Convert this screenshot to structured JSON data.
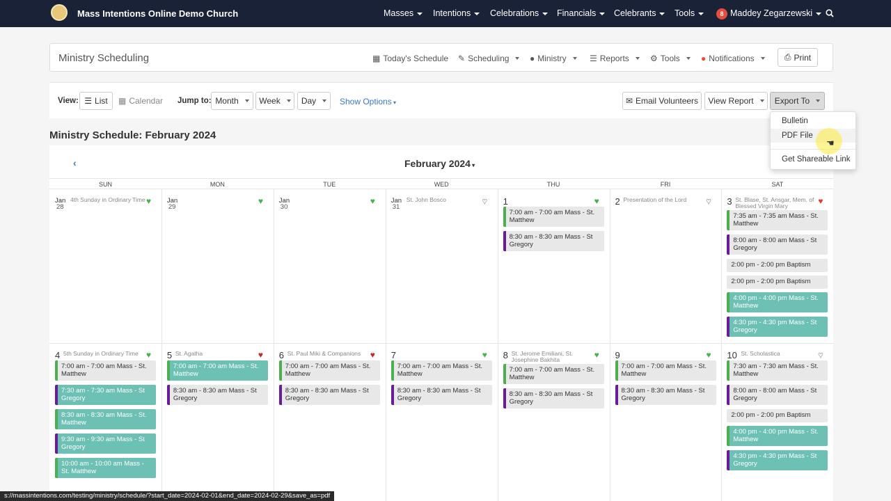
{
  "nav": {
    "brand": "Mass Intentions Online Demo Church",
    "items": [
      "Masses",
      "Intentions",
      "Celebrations",
      "Financials",
      "Celebrants",
      "Tools"
    ],
    "badge": "8",
    "user": "Maddey Zegarzewski"
  },
  "panel": {
    "title": "Ministry Scheduling",
    "menu": [
      "Today's Schedule",
      "Scheduling",
      "Ministry",
      "Reports",
      "Tools",
      "Notifications"
    ],
    "print": "Print"
  },
  "toolbar": {
    "view_label": "View:",
    "list": "List",
    "calendar": "Calendar",
    "jump_label": "Jump to:",
    "month": "Month",
    "week": "Week",
    "day": "Day",
    "show_options": "Show Options",
    "email": "Email Volunteers",
    "view_report": "View Report",
    "export": "Export To"
  },
  "dropdown": {
    "bulletin": "Bulletin",
    "pdf": "PDF File",
    "share": "Get Shareable Link"
  },
  "heading": "Ministry Schedule: February 2024",
  "calendar": {
    "month_title": "February 2024",
    "dow": [
      "SUN",
      "MON",
      "TUE",
      "WED",
      "THU",
      "FRI",
      "SAT"
    ],
    "week1": [
      {
        "num": "Jan",
        "sub": "28",
        "feast": "4th Sunday in Ordinary Time",
        "events": []
      },
      {
        "num": "Jan",
        "sub": "29",
        "feast": "",
        "events": []
      },
      {
        "num": "Jan",
        "sub": "30",
        "feast": "",
        "events": []
      },
      {
        "num": "Jan",
        "sub": "31",
        "feast": "St. John Bosco",
        "events": []
      },
      {
        "num": "1",
        "feast": "",
        "events": [
          {
            "t": "7:00 am - 7:00 am Mass - St. Matthew",
            "s": "g"
          },
          {
            "t": "8:30 am - 8:30 am Mass - St Gregory",
            "s": "p"
          }
        ]
      },
      {
        "num": "2",
        "feast": "Presentation of the Lord",
        "events": []
      },
      {
        "num": "3",
        "feast": "St. Blase, St. Ansgar, Mem. of Blessed Virgin Mary",
        "events": [
          {
            "t": "7:35 am - 7:35 am Mass - St. Matthew",
            "s": "g"
          },
          {
            "t": "8:00 am - 8:00 am Mass - St Gregory",
            "s": "p"
          },
          {
            "t": "2:00 pm - 2:00 pm Baptism",
            "s": "n"
          },
          {
            "t": "2:00 pm - 2:00 pm Baptism",
            "s": "n"
          },
          {
            "t": "4:00 pm - 4:00 pm Mass - St. Matthew",
            "s": "tg"
          },
          {
            "t": "4:30 pm - 4:30 pm Mass - St Gregory",
            "s": "tp"
          }
        ]
      }
    ],
    "week2": [
      {
        "num": "4",
        "feast": "5th Sunday in Ordinary Time",
        "events": [
          {
            "t": "7:00 am - 7:00 am Mass - St. Matthew",
            "s": "g"
          },
          {
            "t": "7:30 am - 7:30 am Mass - St Gregory",
            "s": "tp"
          },
          {
            "t": "8:30 am - 8:30 am Mass - St. Matthew",
            "s": "tg"
          },
          {
            "t": "9:30 am - 9:30 am Mass - St Gregory",
            "s": "tp"
          },
          {
            "t": "10:00 am - 10:00 am Mass - St. Matthew",
            "s": "tg"
          }
        ]
      },
      {
        "num": "5",
        "feast": "St. Agatha",
        "events": [
          {
            "t": "7:00 am - 7:00 am Mass - St. Matthew",
            "s": "tg"
          },
          {
            "t": "8:30 am - 8:30 am Mass - St Gregory",
            "s": "p"
          }
        ]
      },
      {
        "num": "6",
        "feast": "St. Paul Miki & Companions",
        "events": [
          {
            "t": "7:00 am - 7:00 am Mass - St. Matthew",
            "s": "g"
          },
          {
            "t": "8:30 am - 8:30 am Mass - St Gregory",
            "s": "p"
          }
        ]
      },
      {
        "num": "7",
        "feast": "",
        "events": [
          {
            "t": "7:00 am - 7:00 am Mass - St. Matthew",
            "s": "g"
          },
          {
            "t": "8:30 am - 8:30 am Mass - St Gregory",
            "s": "p"
          }
        ]
      },
      {
        "num": "8",
        "feast": "St. Jerome Emiliani, St. Josephine Bakhita",
        "events": [
          {
            "t": "7:00 am - 7:00 am Mass - St. Matthew",
            "s": "g"
          },
          {
            "t": "8:30 am - 8:30 am Mass - St Gregory",
            "s": "p"
          }
        ]
      },
      {
        "num": "9",
        "feast": "",
        "events": [
          {
            "t": "7:00 am - 7:00 am Mass - St. Matthew",
            "s": "g"
          },
          {
            "t": "8:30 am - 8:30 am Mass - St Gregory",
            "s": "p"
          }
        ]
      },
      {
        "num": "10",
        "feast": "St. Scholastica",
        "events": [
          {
            "t": "7:30 am - 7:30 am Mass - St. Matthew",
            "s": "g"
          },
          {
            "t": "8:00 am - 8:00 am Mass - St Gregory",
            "s": "p"
          },
          {
            "t": "2:00 pm - 2:00 pm Baptism",
            "s": "n"
          },
          {
            "t": "4:00 pm - 4:00 pm Mass - St. Matthew",
            "s": "tg"
          },
          {
            "t": "4:30 pm - 4:30 pm Mass - St Gregory",
            "s": "tp"
          }
        ]
      }
    ]
  },
  "status_url": "s://massintentions.com/testing/ministry/schedule/?start_date=2024-02-01&end_date=2024-02-29&save_as=pdf",
  "colors": {
    "nav_bg": "#1a2238",
    "green": "#4caf50",
    "purple": "#6a1b9a",
    "teal": "#6cc0b4",
    "link": "#3b78c3"
  }
}
